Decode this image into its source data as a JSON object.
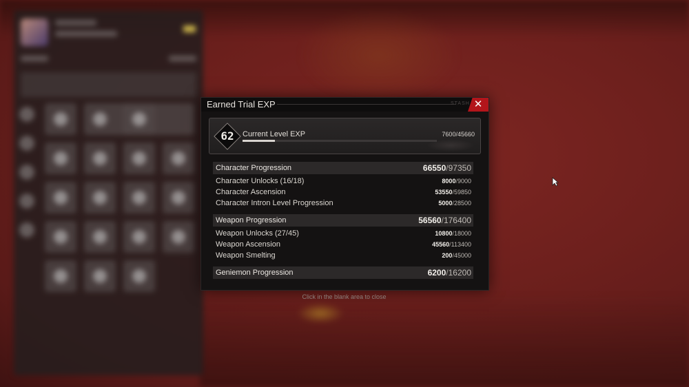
{
  "dialog": {
    "title": "Earned Trial EXP",
    "header_tag": "STASH",
    "close_icon": "close-icon"
  },
  "level": {
    "number": "62",
    "label": "Current Level EXP",
    "current": "7600",
    "max": "45660",
    "progress": 0.166
  },
  "sections": [
    {
      "label": "Character Progression",
      "current": "66550",
      "max": "97350",
      "rows": [
        {
          "label": "Character Unlocks (16/18)",
          "current": "8000",
          "max": "9000"
        },
        {
          "label": "Character Ascension",
          "current": "53550",
          "max": "59850"
        },
        {
          "label": "Character Intron Level Progression",
          "current": "5000",
          "max": "28500"
        }
      ]
    },
    {
      "label": "Weapon Progression",
      "current": "56560",
      "max": "176400",
      "rows": [
        {
          "label": "Weapon Unlocks (27/45)",
          "current": "10800",
          "max": "18000"
        },
        {
          "label": "Weapon Ascension",
          "current": "45560",
          "max": "113400"
        },
        {
          "label": "Weapon Smelting",
          "current": "200",
          "max": "45000"
        }
      ]
    },
    {
      "label": "Geniemon Progression",
      "current": "6200",
      "max": "16200",
      "rows": []
    }
  ],
  "close_hint": "Click in the blank area to close",
  "colors": {
    "accent_close": "#b3151b",
    "dialog_bg": "#141212",
    "background": "#6e201d"
  }
}
